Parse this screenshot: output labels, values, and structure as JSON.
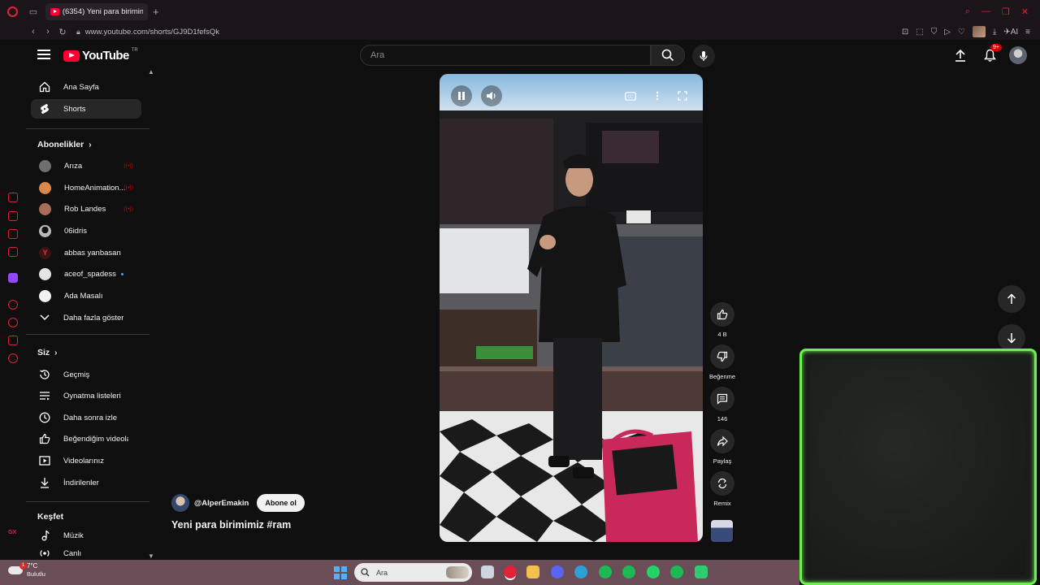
{
  "browser": {
    "tab_title": "(6354) Yeni para birimimiz",
    "url": "www.youtube.com/shorts/GJ9D1fefsQk",
    "ai_label": "AI"
  },
  "header": {
    "logo_text": "YouTube",
    "country_code": "TR",
    "search_placeholder": "Ara",
    "notification_count": "9+"
  },
  "sidebar": {
    "main": [
      {
        "label": "Ana Sayfa",
        "icon": "home-icon"
      },
      {
        "label": "Shorts",
        "icon": "shorts-icon",
        "active": true
      }
    ],
    "subscriptions_title": "Abonelikler",
    "subscriptions": [
      {
        "label": "Arıza",
        "live": true,
        "color": "#6f6f6f"
      },
      {
        "label": "HomeAnimation...",
        "live": true,
        "color": "#d9894a"
      },
      {
        "label": "Rob Landes",
        "live": true,
        "color": "#a86d5a"
      },
      {
        "label": "06idris",
        "live": false,
        "color": "#b9b9b9"
      },
      {
        "label": "abbas yanbasan",
        "live": false,
        "color": "#6b1e1e"
      },
      {
        "label": "aceof_spadess",
        "new": true,
        "color": "#e4e4e4"
      },
      {
        "label": "Ada Masalı",
        "live": false,
        "color": "#f1f1f1"
      }
    ],
    "show_more": "Daha fazla göster",
    "you_title": "Siz",
    "you_items": [
      {
        "label": "Geçmiş",
        "icon": "history-icon"
      },
      {
        "label": "Oynatma listeleri",
        "icon": "playlist-icon"
      },
      {
        "label": "Daha sonra izle",
        "icon": "clock-icon"
      },
      {
        "label": "Beğendiğim videolar",
        "icon": "like-icon"
      },
      {
        "label": "Videolarınız",
        "icon": "video-icon"
      },
      {
        "label": "İndirilenler",
        "icon": "download-icon"
      }
    ],
    "explore_title": "Keşfet",
    "explore_items": [
      {
        "label": "Müzik",
        "icon": "music-icon"
      },
      {
        "label": "Canlı",
        "icon": "live-icon"
      }
    ]
  },
  "video": {
    "channel": "@AlperEmakin",
    "subscribe": "Abone ol",
    "title": "Yeni para birimimiz #ram"
  },
  "actions": {
    "likes": "4 B",
    "dislike": "Beğenme",
    "comments": "146",
    "share": "Paylaş",
    "remix": "Remix"
  },
  "taskbar": {
    "temp": "7°C",
    "weather": "Bulutlu",
    "search": "Ara",
    "alert_count": "1"
  }
}
